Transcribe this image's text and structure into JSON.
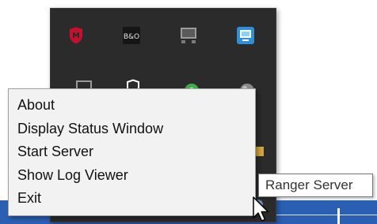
{
  "context_menu": {
    "items": [
      {
        "label": "About"
      },
      {
        "label": "Display Status Window"
      },
      {
        "label": "Start Server"
      },
      {
        "label": "Show Log Viewer"
      },
      {
        "label": "Exit"
      }
    ]
  },
  "tooltip": {
    "text": "Ranger Server"
  },
  "tray_icons": [
    {
      "name": "mcafee-shield-icon",
      "color": "#c8102e"
    },
    {
      "name": "bang-olufsen-icon",
      "color": "#1c1c1c"
    },
    {
      "name": "network-computer-icon",
      "color": "#9a9a9a"
    },
    {
      "name": "remote-desktop-icon",
      "color": "#2f8fd8"
    },
    {
      "name": "monitor-icon",
      "color": "#9a9a9a"
    },
    {
      "name": "shield-icon",
      "color": "#ffffff"
    },
    {
      "name": "green-status-icon",
      "color": "#3fae49"
    },
    {
      "name": "gray-globe-icon",
      "color": "#8a8a8a"
    }
  ],
  "colors": {
    "tray_background": "#2b2b2b",
    "menu_background": "#f2f2f2",
    "taskbar": "#2a5fb4"
  }
}
